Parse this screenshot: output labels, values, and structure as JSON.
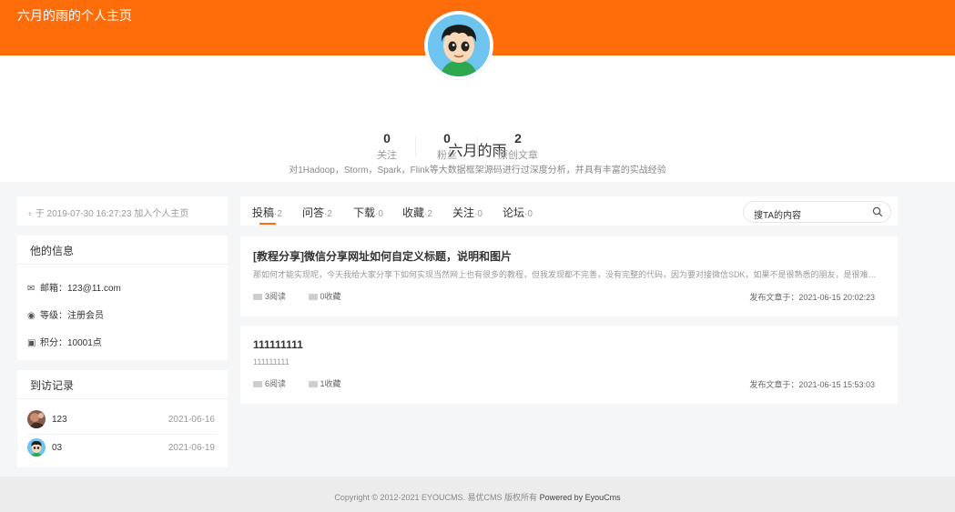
{
  "header": {
    "site_title": "六月的雨的个人主页"
  },
  "profile": {
    "name": "六月的雨",
    "bio": "对1Hadoop，Storm，Spark，Flink等大数据框架源码进行过深度分析，并具有丰富的实战经验",
    "stats": [
      {
        "num": "0",
        "label": "关注"
      },
      {
        "num": "0",
        "label": "粉丝"
      },
      {
        "num": "2",
        "label": "原创文章"
      }
    ]
  },
  "sidebar": {
    "join_text": "于 2019-07-30 16:27:23 加入个人主页",
    "info": {
      "title": "他的信息",
      "email": "邮箱：123@11.com",
      "level": "等级：注册会员",
      "points": "积分：10001点"
    },
    "visits": {
      "title": "到访记录",
      "items": [
        {
          "name": "123",
          "date": "2021-06-16"
        },
        {
          "name": "03",
          "date": "2021-06-19"
        }
      ]
    }
  },
  "tabs": [
    {
      "label": "投稿",
      "count": "·2"
    },
    {
      "label": "问答",
      "count": "·2"
    },
    {
      "label": "下载",
      "count": "·0"
    },
    {
      "label": "收藏",
      "count": "·2"
    },
    {
      "label": "关注",
      "count": "·0"
    },
    {
      "label": "论坛",
      "count": "·0"
    }
  ],
  "search": {
    "placeholder": "搜TA的内容"
  },
  "articles": [
    {
      "title": "[教程分享]微信分享网址如何自定义标题，说明和图片",
      "desc": "那如何才能实现呢，今天我给大家分享下如何实现当然网上也有很多的教程，但我发现都不完善，没有完整的代码，因为要对接微信SDK，如果不是很熟悉的朋友，是很难实现的",
      "reads": "3阅读",
      "favs": "0收藏",
      "date": "发布文章于：2021-06-15 20:02:23"
    },
    {
      "title": "111111111",
      "desc": "111111111",
      "reads": "6阅读",
      "favs": "1收藏",
      "date": "发布文章于：2021-06-15 15:53:03"
    }
  ],
  "footer": {
    "copyright": "Copyright © 2012-2021 EYOUCMS. 易优CMS 版权所有",
    "powered": "Powered by EyouCms"
  },
  "colors": {
    "accent": "#ff6c0a",
    "background": "#f5f6f8"
  }
}
